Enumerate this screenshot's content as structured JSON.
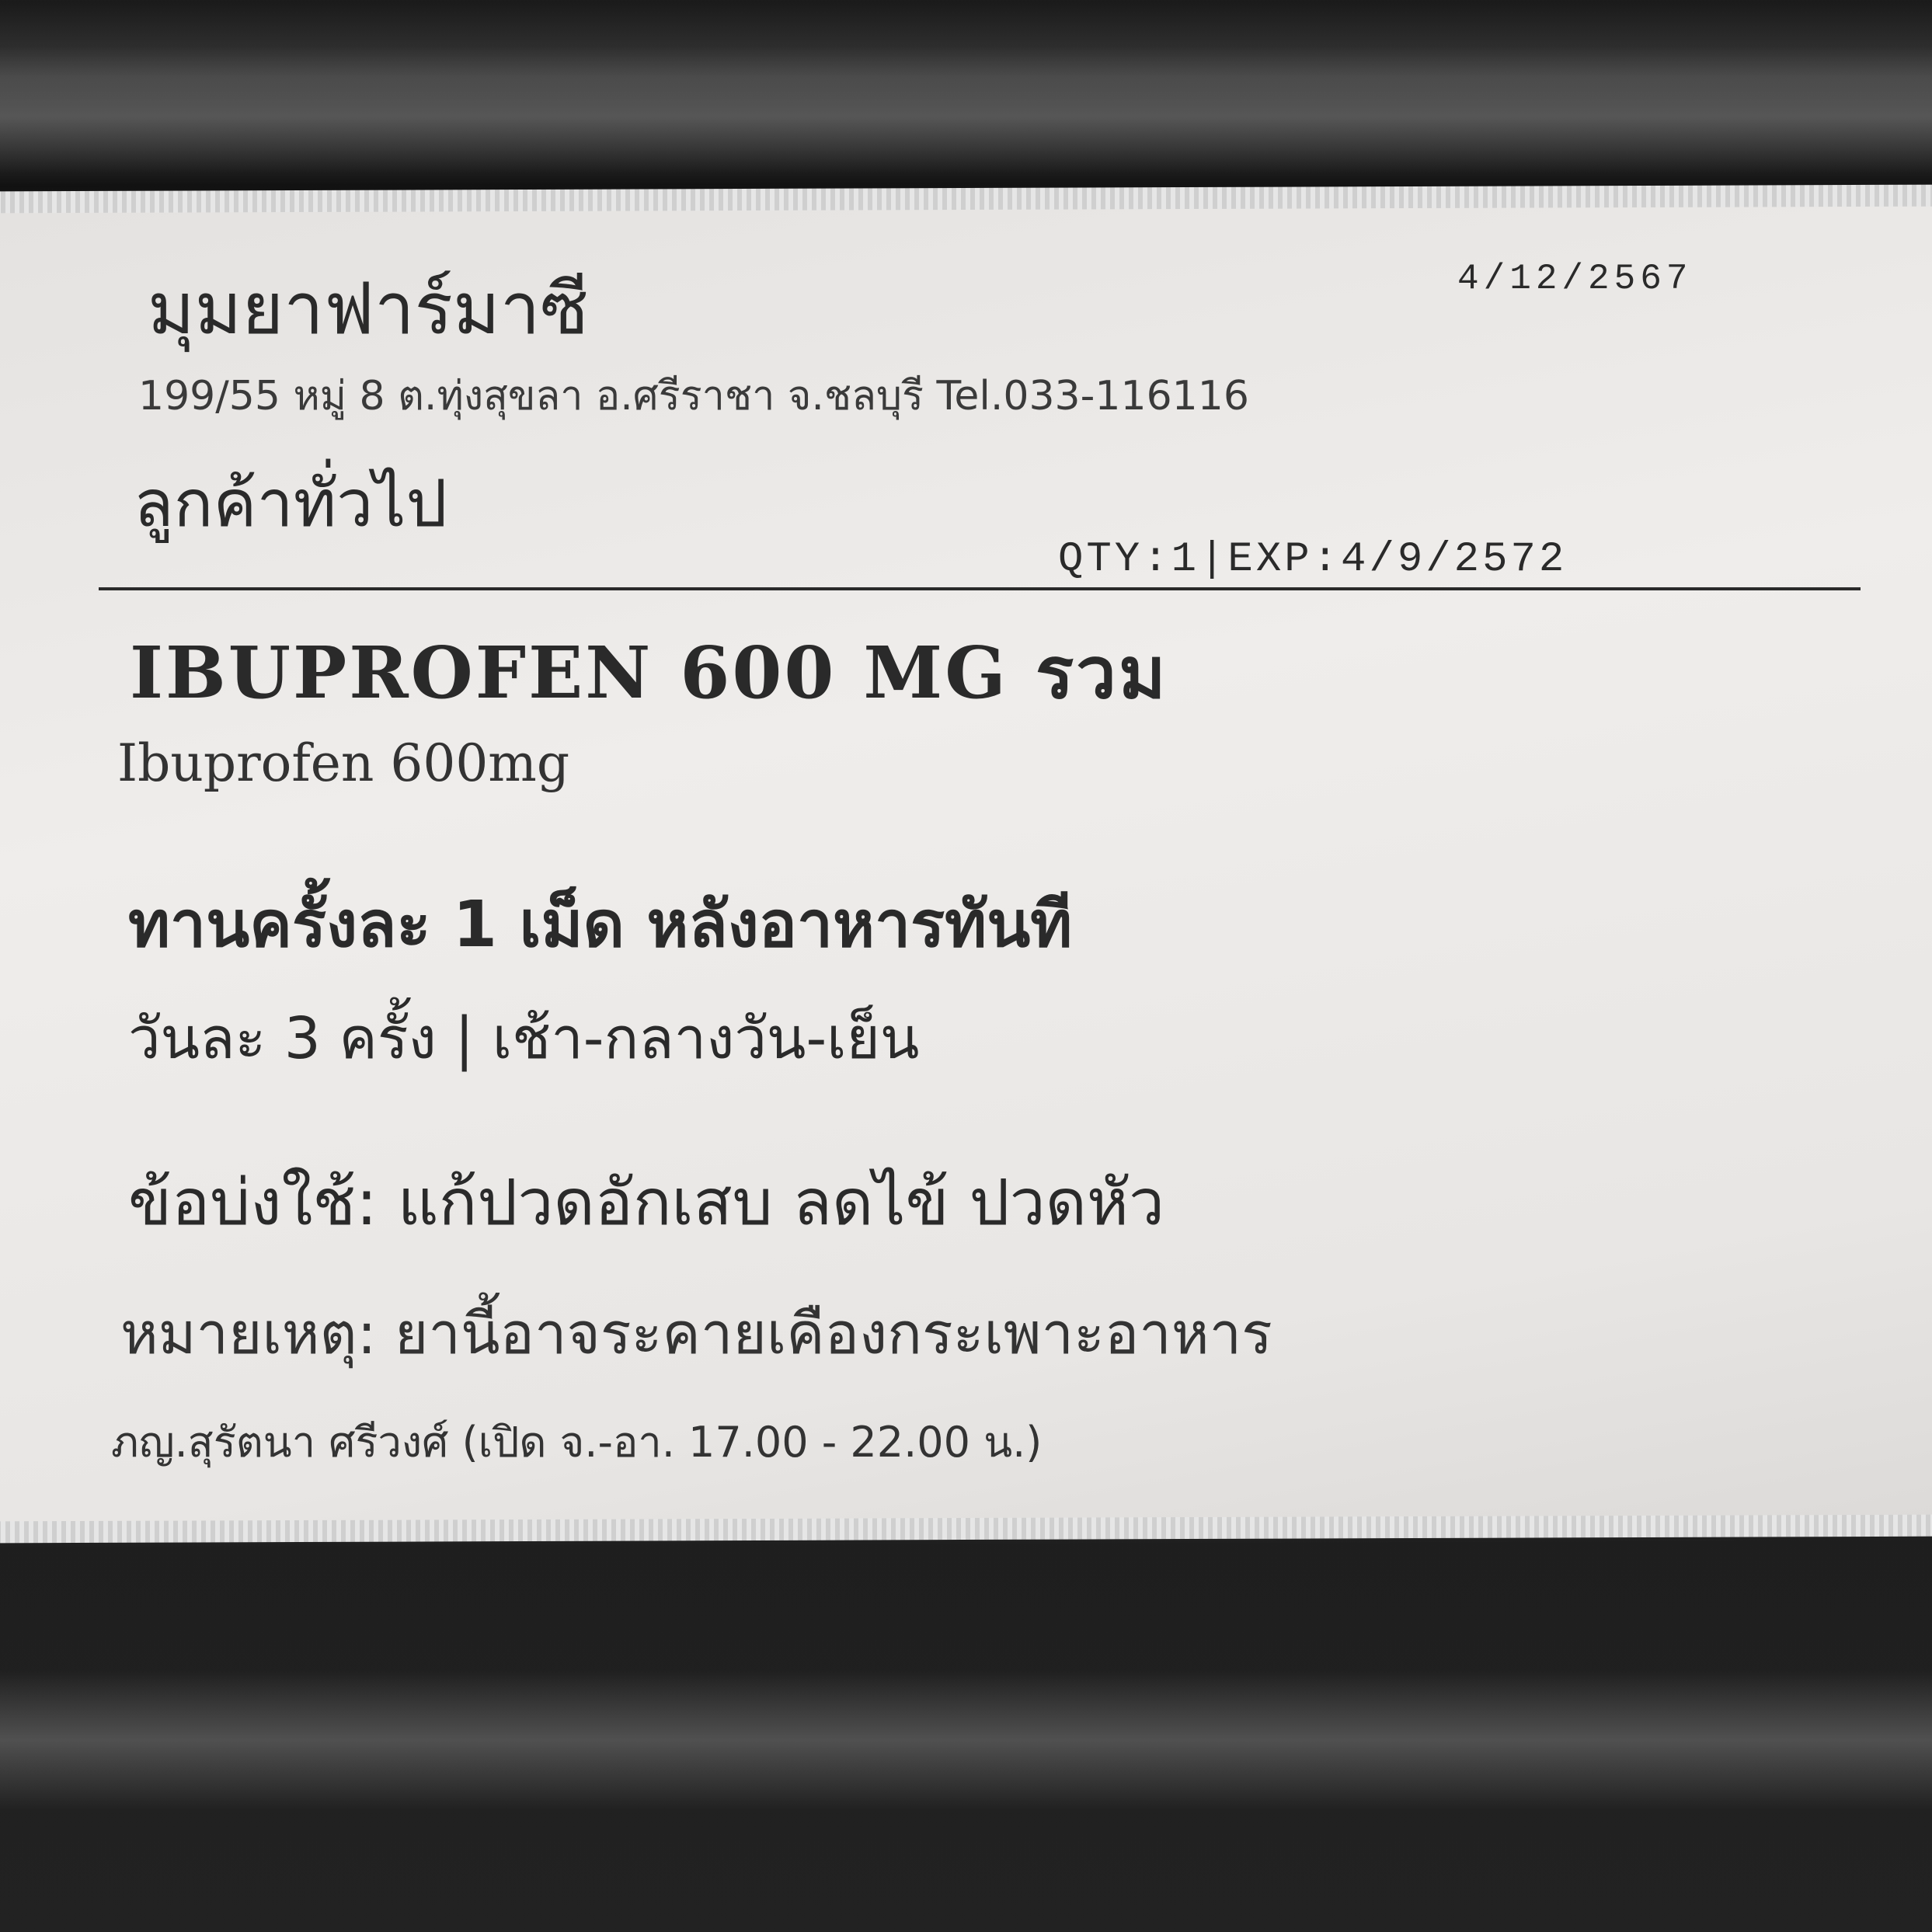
{
  "pharmacy": {
    "name": "มุมยาฟาร์มาซี",
    "address": "199/55 หมู่ 8 ต.ทุ่งสุขลา อ.ศรีราชา จ.ชลบุรี Tel.033-116116",
    "date": "4/12/2567"
  },
  "customer": "ลูกค้าทั่วไป",
  "qty_exp": "QTY:1|EXP:4/9/2572",
  "drug": {
    "name": "IBUPROFEN 600 MG รวม",
    "generic": "Ibuprofen 600mg"
  },
  "instructions": {
    "line1": "ทานครั้งละ 1 เม็ด หลังอาหารทันที",
    "line2": "วันละ 3 ครั้ง | เช้า-กลางวัน-เย็น"
  },
  "indication": "ข้อบ่งใช้: แก้ปวดอักเสบ ลดไข้ ปวดหัว",
  "note": "หมายเหตุ: ยานี้อาจระคายเคืองกระเพาะอาหาร",
  "pharmacist": "ภญ.สุรัตนา ศรีวงศ์ (เปิด จ.-อา. 17.00 - 22.00 น.)"
}
